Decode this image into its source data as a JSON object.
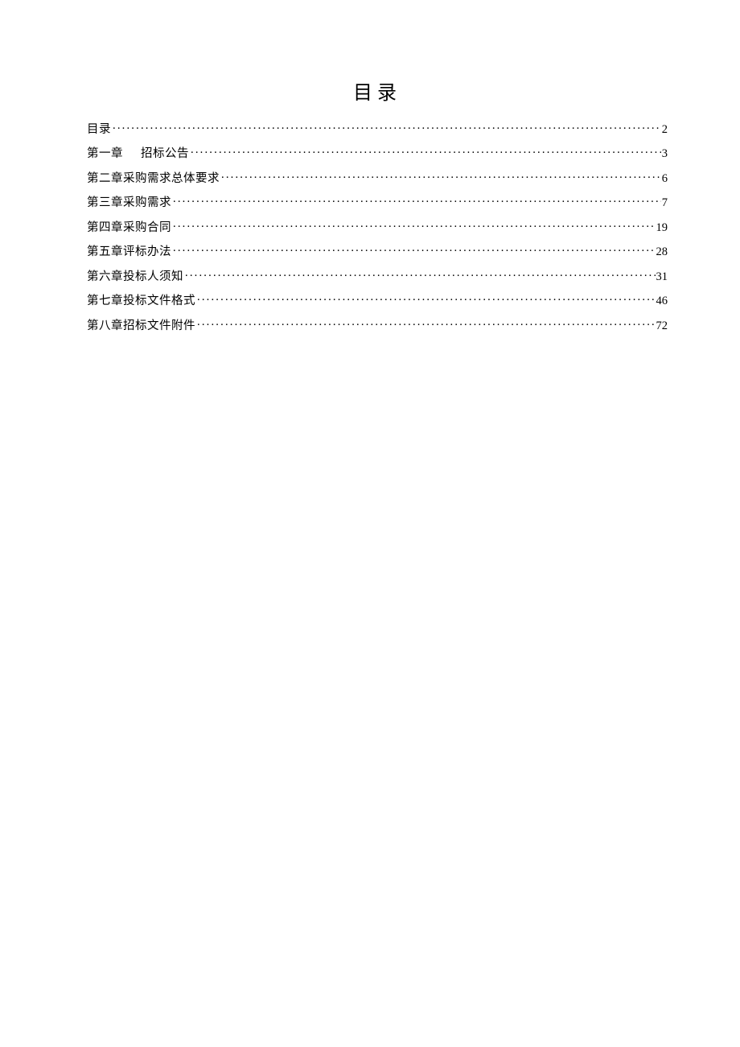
{
  "title": "目录",
  "toc": [
    {
      "label": "目录",
      "page": "2"
    },
    {
      "label": "第一章<span class=\"gap\"></span>招标公告",
      "page": "3"
    },
    {
      "label": "第二章采购需求总体要求",
      "page": "6"
    },
    {
      "label": "第三章采购需求",
      "page": "7"
    },
    {
      "label": "第四章采购合同",
      "page": "19"
    },
    {
      "label": "第五章评标办法",
      "page": "28"
    },
    {
      "label": "第六章投标人须知",
      "page": "31"
    },
    {
      "label": "第七章投标文件格式",
      "page": "46"
    },
    {
      "label": "第八章招标文件附件",
      "page": "72"
    }
  ]
}
